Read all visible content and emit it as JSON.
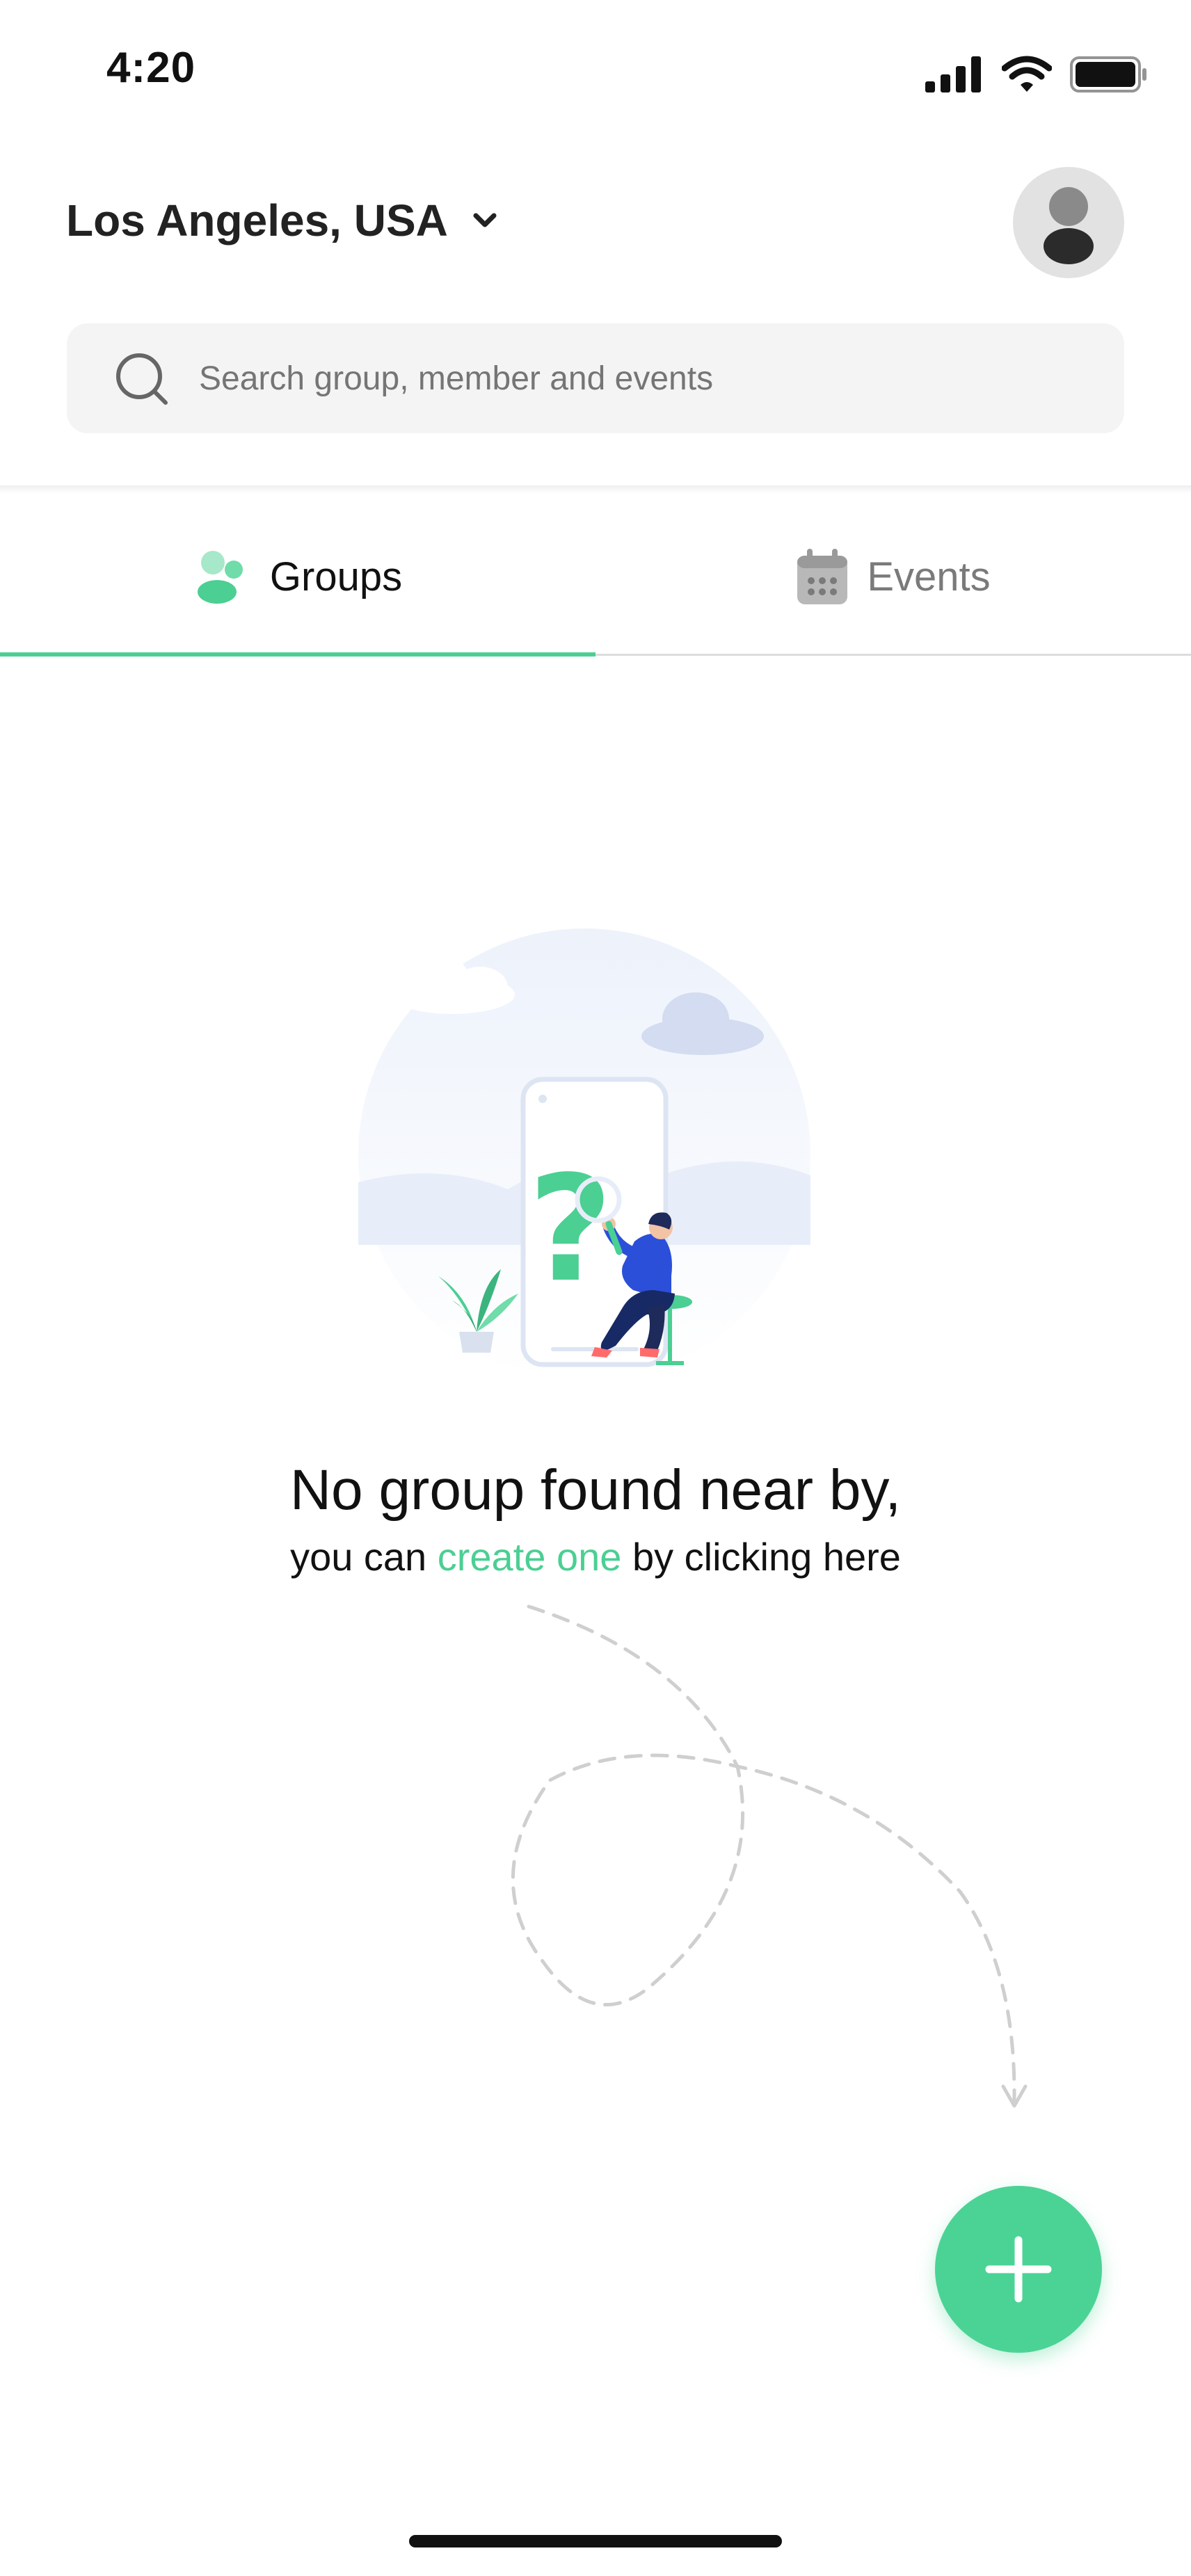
{
  "status_bar": {
    "time": "4:20",
    "icons": [
      "cellular-signal-icon",
      "wifi-icon",
      "battery-icon"
    ]
  },
  "header": {
    "location": "Los Angeles, USA",
    "location_icon": "chevron-down-icon",
    "avatar_icon": "user-avatar-icon"
  },
  "search": {
    "placeholder": "Search group, member and events",
    "icon": "search-icon"
  },
  "tabs": [
    {
      "label": "Groups",
      "icon": "groups-icon",
      "active": true
    },
    {
      "label": "Events",
      "icon": "calendar-icon",
      "active": false
    }
  ],
  "empty_state": {
    "illustration": "search-phone-question-illustration",
    "title": "No group found near by,",
    "subtitle_before": "you can ",
    "subtitle_link": "create one",
    "subtitle_after": " by clicking here"
  },
  "fab": {
    "icon": "plus-icon"
  },
  "colors": {
    "accent": "#4bcf93",
    "search_bg": "#f4f4f4",
    "text_primary": "#111111",
    "text_muted": "#7a7a7a",
    "illustration_blue": "#2b4fd8"
  }
}
